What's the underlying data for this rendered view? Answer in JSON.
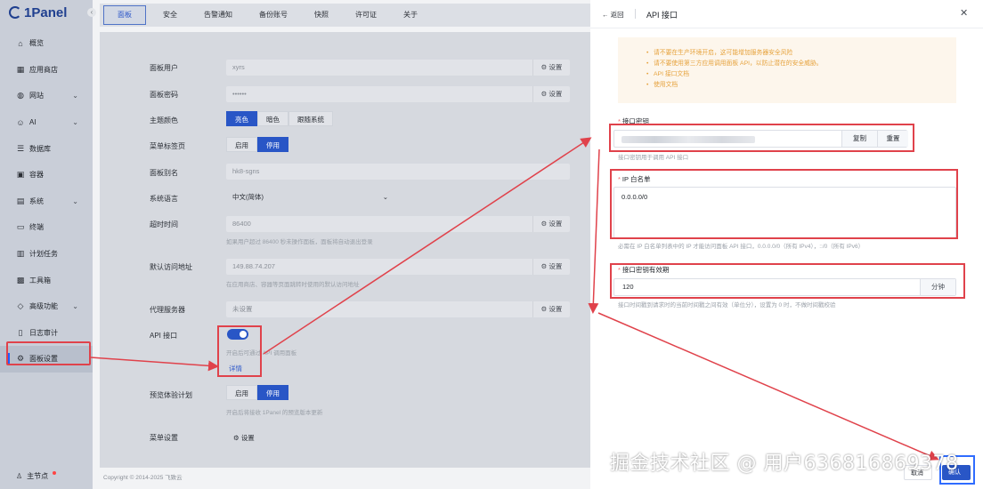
{
  "app": {
    "name": "1Panel"
  },
  "sidebar": {
    "items": [
      {
        "label": "概览",
        "icon": "home-icon",
        "chevron": false
      },
      {
        "label": "应用商店",
        "icon": "apps-icon",
        "chevron": false
      },
      {
        "label": "网站",
        "icon": "globe-icon",
        "chevron": true
      },
      {
        "label": "AI",
        "icon": "robot-icon",
        "chevron": true
      },
      {
        "label": "数据库",
        "icon": "database-icon",
        "chevron": false
      },
      {
        "label": "容器",
        "icon": "container-icon",
        "chevron": false
      },
      {
        "label": "系统",
        "icon": "server-icon",
        "chevron": true
      },
      {
        "label": "终端",
        "icon": "terminal-icon",
        "chevron": false
      },
      {
        "label": "计划任务",
        "icon": "calendar-icon",
        "chevron": false
      },
      {
        "label": "工具箱",
        "icon": "toolbox-icon",
        "chevron": false
      },
      {
        "label": "高级功能",
        "icon": "diamond-icon",
        "chevron": true
      },
      {
        "label": "日志审计",
        "icon": "log-icon",
        "chevron": false
      },
      {
        "label": "面板设置",
        "icon": "gear-icon",
        "chevron": false,
        "active": true
      }
    ],
    "user": "主节点"
  },
  "tabs": [
    "面板",
    "安全",
    "告警通知",
    "备份账号",
    "快照",
    "许可证",
    "关于"
  ],
  "settings": {
    "panel_user": {
      "label": "面板用户",
      "value": "xyrs",
      "action": "设置"
    },
    "panel_password": {
      "label": "面板密码",
      "value": "••••••",
      "action": "设置"
    },
    "theme": {
      "label": "主题颜色",
      "options": [
        "亮色",
        "暗色",
        "跟随系统"
      ],
      "selected": 0
    },
    "menu_tab": {
      "label": "菜单标签页",
      "options": [
        "启用",
        "停用"
      ],
      "selected": 1
    },
    "panel_alias": {
      "label": "面板别名",
      "value": "hk8-sgns"
    },
    "language": {
      "label": "系统语言",
      "value": "中文(简体)"
    },
    "timeout": {
      "label": "超时时间",
      "value": "86400",
      "action": "设置",
      "hint": "如果用户超过 86400 秒未操作面板，面板将自动退出登录"
    },
    "default_address": {
      "label": "默认访问地址",
      "value": "149.88.74.207",
      "action": "设置",
      "hint": "在应用商店、容器等页面跳转时使用的默认访问地址"
    },
    "proxy": {
      "label": "代理服务器",
      "value": "未设置",
      "action": "设置"
    },
    "api": {
      "label": "API 接口",
      "hint": "开启后可通过 API 调用面板",
      "detail": "详情"
    },
    "preview": {
      "label": "预览体验计划",
      "options": [
        "启用",
        "停用"
      ],
      "selected": 1,
      "hint": "开启后将接收 1Panel 的预览版本更新"
    },
    "menu_settings": {
      "label": "菜单设置",
      "action": "设置"
    }
  },
  "footer": "Copyright © 2014-2025 飞致云",
  "drawer": {
    "back": "返回",
    "title": "API 接口",
    "warnings": [
      "请不要在生产环境开启，这可能增加服务器安全风险",
      "请不要使用第三方应用调用面板 API，以防止潜在的安全威胁。",
      "API 接口文档",
      "使用文档"
    ],
    "secret": {
      "label": "接口密钥",
      "copy": "复制",
      "reset": "重置",
      "hint": "接口密钥用于调用 API 接口"
    },
    "whitelist": {
      "label": "IP 白名单",
      "value": "0.0.0.0/0",
      "hint": "必需在 IP 白名单列表中的 IP 才能访问面板 API 接口，0.0.0.0/0（所有 IPv4），::/0（所有 IPv6）"
    },
    "validity": {
      "label": "接口密钥有效期",
      "value": "120",
      "unit": "分钟",
      "hint": "接口时间戳到请求时的当前时间戳之间有效（单位分），设置为 0 时，不做时间戳校验"
    },
    "cancel": "取消",
    "confirm": "确认"
  },
  "watermark": "掘金技术社区 @ 用户63681686937​8",
  "colors": {
    "accent": "#2956c6",
    "annotation": "#e0424b",
    "warning": "#e6a23c"
  }
}
